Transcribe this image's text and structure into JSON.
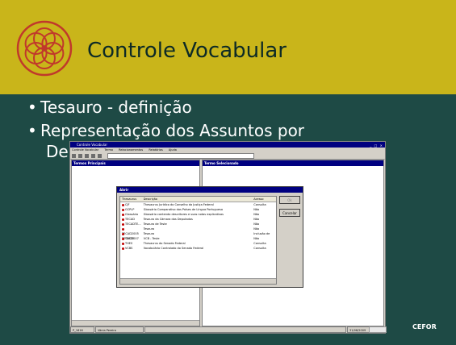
{
  "slide": {
    "title": "Controle Vocabular",
    "bullets": [
      "Tesauro - definição",
      "Representação dos Assuntos por",
      "De"
    ],
    "bullet_symbol": "•",
    "footer_logo_text": "CEFOR"
  },
  "app": {
    "window_title": "Controle Vocabular",
    "window_controls": "_ □ ×",
    "menu": [
      "Controle Vocabular",
      "Termo",
      "Relacionamentos",
      "Relatórios",
      "Ajuda"
    ],
    "left_pane_header": "Termos Principais",
    "right_pane_header": "Termo Selecionado",
    "status": [
      "P_1616",
      "Vânia Pereira",
      "",
      "31/08/2009"
    ]
  },
  "dialog": {
    "title": "Abrir",
    "columns": [
      "Thesaurus",
      "Descrição",
      "Acesso"
    ],
    "rows": [
      {
        "code": "CJF",
        "desc": "Thesaurus Jurídico do Conselho da Justiça Federal",
        "access": "Consulta"
      },
      {
        "code": "GCPLP",
        "desc": "Glossário Comparativo dos Países de Língua Portuguesa",
        "access": "Não"
      },
      {
        "code": "Glossário",
        "desc": "Glossário contendo descritores e suas notas explicativas",
        "access": "Não"
      },
      {
        "code": "TECAD",
        "desc": "Tesauro da Câmara dos Deputados",
        "access": "Não"
      },
      {
        "code": "TECADTE...",
        "desc": "Tesauro de Teste",
        "access": "Não"
      },
      {
        "code": "TECAD2005",
        "desc": "Tesauro",
        "access": "Não"
      },
      {
        "code": "TECAD2007",
        "desc": "Tesauro",
        "access": "Inclusão de"
      },
      {
        "code": "TESTE",
        "desc": "VCB - Teste",
        "access": "Não"
      },
      {
        "code": "THES",
        "desc": "Thesaurus do Senado Federal",
        "access": "Consulta"
      },
      {
        "code": "VCBS",
        "desc": "Vocabulário Controlado do Senado Federal",
        "access": "Consulta"
      }
    ],
    "ok_label": "Ok",
    "cancel_label": "Cancelar"
  }
}
